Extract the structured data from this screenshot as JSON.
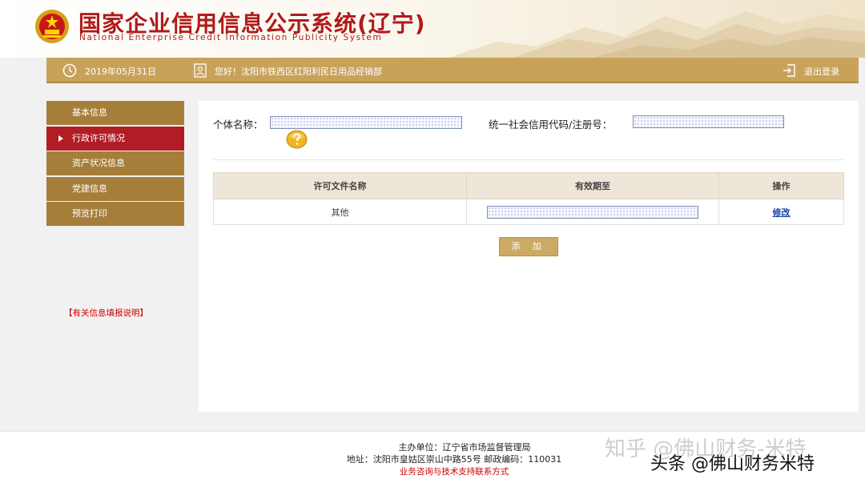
{
  "header": {
    "title": "国家企业信用信息公示系统(辽宁)",
    "subtitle": "National Enterprise Credit Information Publicity System"
  },
  "infobar": {
    "date": "2019年05月31日",
    "greeting": "您好！沈阳市铁西区红阳利民日用品经销部",
    "logout_label": "退出登录"
  },
  "sidebar": {
    "items": [
      {
        "label": "基本信息"
      },
      {
        "label": "行政许可情况"
      },
      {
        "label": "资产状况信息"
      },
      {
        "label": "党建信息"
      },
      {
        "label": "预览打印"
      }
    ],
    "note": "【有关信息填报说明】"
  },
  "form": {
    "name_label": "个体名称：",
    "code_label": "统一社会信用代码/注册号："
  },
  "table": {
    "headers": [
      "许可文件名称",
      "有效期至",
      "操作"
    ],
    "rows": [
      {
        "name": "其他",
        "action": "修改"
      }
    ]
  },
  "add_button": "添 加",
  "footer": {
    "sponsor": "主办单位：辽宁省市场监督管理局",
    "address": "地址：沈阳市皇姑区崇山中路55号 邮政编码：110031",
    "support": "业务咨询与技术支持联系方式"
  },
  "watermarks": {
    "zhihu": "知乎 @佛山财务-米特",
    "toutiao": "头条 @佛山财务米特"
  },
  "colors": {
    "brand_red": "#b11a1a",
    "bar_gold": "#c9a25a",
    "sidebar_gold": "#a57e3a",
    "active_red": "#b21c24",
    "link_blue": "#1a3fa8"
  }
}
